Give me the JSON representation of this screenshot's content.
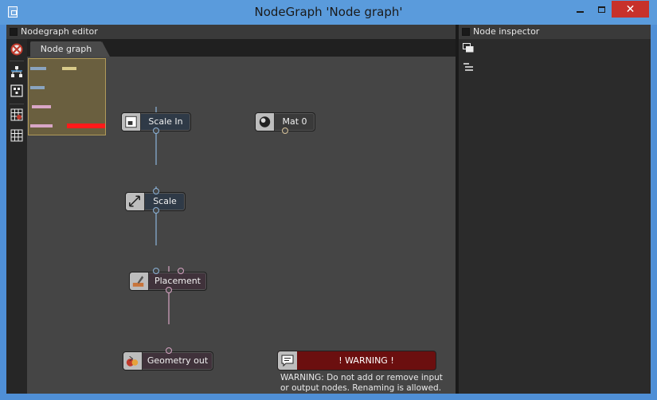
{
  "window": {
    "title": "NodeGraph 'Node graph'",
    "min_label": "",
    "max_label": "",
    "close_label": "✕"
  },
  "left_panel": {
    "header": "Nodegraph editor",
    "tabs": [
      {
        "label": "Node graph"
      }
    ]
  },
  "right_panel": {
    "header": "Node inspector"
  },
  "nodes": {
    "scale_in": {
      "label": "Scale In",
      "icon": "scale-in-icon"
    },
    "mat0": {
      "label": "Mat 0",
      "icon": "material-icon"
    },
    "scale": {
      "label": "Scale",
      "icon": "scale-icon"
    },
    "placement": {
      "label": "Placement",
      "icon": "placement-icon"
    },
    "geometry_out": {
      "label": "Geometry out",
      "icon": "geometry-out-icon"
    },
    "warning": {
      "label": "! WARNING !",
      "icon": "comment-icon"
    }
  },
  "warning_text": "WARNING: Do not add or remove input or output nodes. Renaming is allowed.",
  "colors": {
    "titlebar": "#5a9bdc",
    "close": "#c7312b",
    "canvas": "#454545",
    "edge_blue": "#8bb3d9",
    "edge_pink": "#d7a3c3",
    "warning": "#6b0f0f",
    "minimap": "#6a5f3f"
  }
}
